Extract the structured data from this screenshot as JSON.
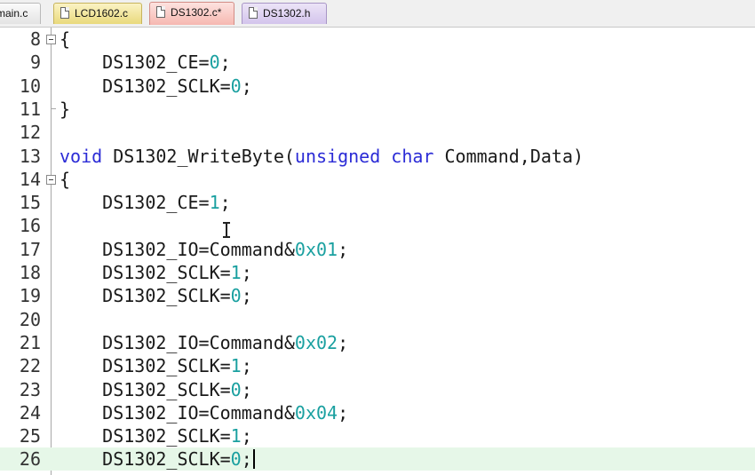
{
  "tabs": [
    {
      "label": "main.c",
      "style": "plain",
      "icon": "document-icon"
    },
    {
      "label": "LCD1602.c",
      "style": "yellow",
      "icon": "document-icon"
    },
    {
      "label": "DS1302.c*",
      "style": "active",
      "icon": "document-icon"
    },
    {
      "label": "DS1302.h",
      "style": "purple",
      "icon": "document-icon"
    }
  ],
  "editor": {
    "current_line": "26",
    "lines": [
      {
        "number": "8",
        "fold": "open",
        "tokens": [
          {
            "t": "{",
            "k": "id"
          }
        ]
      },
      {
        "number": "9",
        "tokens": [
          {
            "t": "    DS1302_CE=",
            "k": "id"
          },
          {
            "t": "0",
            "k": "num"
          },
          {
            "t": ";",
            "k": "id"
          }
        ]
      },
      {
        "number": "10",
        "tokens": [
          {
            "t": "    DS1302_SCLK=",
            "k": "id"
          },
          {
            "t": "0",
            "k": "num"
          },
          {
            "t": ";",
            "k": "id"
          }
        ]
      },
      {
        "number": "11",
        "fold": "end",
        "tokens": [
          {
            "t": "}",
            "k": "id"
          }
        ]
      },
      {
        "number": "12",
        "tokens": []
      },
      {
        "number": "13",
        "tokens": [
          {
            "t": "void",
            "k": "kw"
          },
          {
            "t": " DS1302_WriteByte(",
            "k": "id"
          },
          {
            "t": "unsigned",
            "k": "kw"
          },
          {
            "t": " ",
            "k": "id"
          },
          {
            "t": "char",
            "k": "kw"
          },
          {
            "t": " Command,Data)",
            "k": "id"
          }
        ]
      },
      {
        "number": "14",
        "fold": "open",
        "tokens": [
          {
            "t": "{",
            "k": "id"
          }
        ]
      },
      {
        "number": "15",
        "tokens": [
          {
            "t": "    DS1302_CE=",
            "k": "id"
          },
          {
            "t": "1",
            "k": "num"
          },
          {
            "t": ";",
            "k": "id"
          }
        ]
      },
      {
        "number": "16",
        "tokens": []
      },
      {
        "number": "17",
        "tokens": [
          {
            "t": "    DS1302_IO=Command&",
            "k": "id"
          },
          {
            "t": "0x01",
            "k": "num"
          },
          {
            "t": ";",
            "k": "id"
          }
        ]
      },
      {
        "number": "18",
        "tokens": [
          {
            "t": "    DS1302_SCLK=",
            "k": "id"
          },
          {
            "t": "1",
            "k": "num"
          },
          {
            "t": ";",
            "k": "id"
          }
        ]
      },
      {
        "number": "19",
        "tokens": [
          {
            "t": "    DS1302_SCLK=",
            "k": "id"
          },
          {
            "t": "0",
            "k": "num"
          },
          {
            "t": ";",
            "k": "id"
          }
        ]
      },
      {
        "number": "20",
        "tokens": []
      },
      {
        "number": "21",
        "tokens": [
          {
            "t": "    DS1302_IO=Command&",
            "k": "id"
          },
          {
            "t": "0x02",
            "k": "num"
          },
          {
            "t": ";",
            "k": "id"
          }
        ]
      },
      {
        "number": "22",
        "tokens": [
          {
            "t": "    DS1302_SCLK=",
            "k": "id"
          },
          {
            "t": "1",
            "k": "num"
          },
          {
            "t": ";",
            "k": "id"
          }
        ]
      },
      {
        "number": "23",
        "tokens": [
          {
            "t": "    DS1302_SCLK=",
            "k": "id"
          },
          {
            "t": "0",
            "k": "num"
          },
          {
            "t": ";",
            "k": "id"
          }
        ]
      },
      {
        "number": "24",
        "tokens": [
          {
            "t": "    DS1302_IO=Command&",
            "k": "id"
          },
          {
            "t": "0x04",
            "k": "num"
          },
          {
            "t": ";",
            "k": "id"
          }
        ]
      },
      {
        "number": "25",
        "tokens": [
          {
            "t": "    DS1302_SCLK=",
            "k": "id"
          },
          {
            "t": "1",
            "k": "num"
          },
          {
            "t": ";",
            "k": "id"
          }
        ]
      },
      {
        "number": "26",
        "tokens": [
          {
            "t": "    DS1302_SCLK=",
            "k": "id"
          },
          {
            "t": "0",
            "k": "num"
          },
          {
            "t": ";",
            "k": "id"
          }
        ]
      }
    ]
  },
  "colors": {
    "keyword": "#2b2bd6",
    "number": "#1aa0a0",
    "current_line_bg": "#e6f7e8",
    "active_tab": "#f6b8b1"
  }
}
